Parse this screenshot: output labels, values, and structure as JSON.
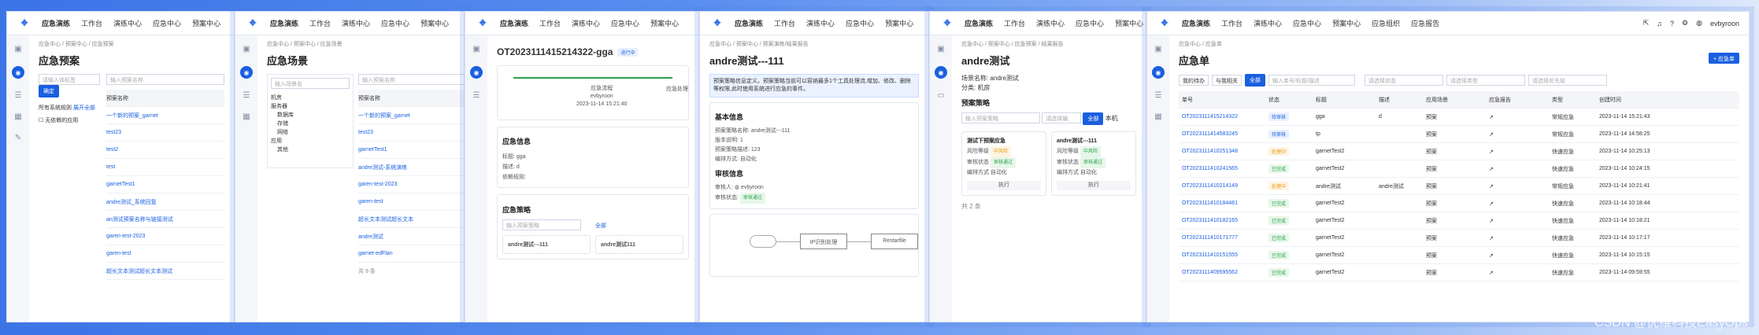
{
  "header": {
    "brand": "应急演练",
    "nav": [
      "工作台",
      "演练中心",
      "应急中心",
      "预案中心",
      "应急组织",
      "应急报告"
    ]
  },
  "p1": {
    "crumb": "应急中心 / 预案中心 / 应急预案",
    "title": "应急预案",
    "search_placeholder": "请输入体标签",
    "btn": "确定",
    "sys": "所有系统规则",
    "expand": "展开全部",
    "check": "无依赖的应用",
    "filter_placeholder": "输入预案名称",
    "col": "预案名称",
    "rows": [
      "一个新的预案_garnet",
      "test23",
      "test2",
      "test",
      "garnetTest1",
      "andre测试_系统回复",
      "an测试预案名称与链接测试",
      "garen-test-2023",
      "garen-test",
      "超长文本测试超长文本测试"
    ]
  },
  "p2": {
    "crumb": "应急中心 / 预案中心 / 应急场景",
    "title": "应急场景",
    "search_placeholder": "输入场景名",
    "tree": [
      "机房",
      "服务器",
      "数据库",
      "存储",
      "网络",
      "应用",
      "其他"
    ],
    "filter_placeholder": "输入预案名称",
    "col": "预案名称",
    "rows": [
      "一个新的预案_garnet",
      "test23",
      "garnetTest1",
      "andre测试-系统演练",
      "garen-test-2023",
      "garen-test",
      "超长文本测试超长文本",
      "andre测试",
      "garnet-edFlan"
    ],
    "footer": "共 9 条"
  },
  "p3": {
    "title": "OT2023111415214322-gga",
    "tag": "进行中",
    "flow_a": "应急流程",
    "flow_b": "应急处理",
    "user": "evbyroon",
    "time": "2023-11-14 15:21:40",
    "sec1": "应急信息",
    "f1": "标题: gga",
    "f2": "描述: d",
    "f3": "依赖规则:",
    "sec2": "应急策略",
    "placeholder": "输入预案策略",
    "card1": "andre测试---111",
    "card2": "andre测试111",
    "all": "全部",
    "num": "123"
  },
  "p4": {
    "crumb": "应急中心 / 预案中心 / 预案演练/结果报告",
    "title": "andre测试---111",
    "note": "预案策略信息定义。预案策略当前可以容纳最多1个工具处理流,增加、修改、删除等权限,此时使用系统进行应急的事件。",
    "sec1": "基本信息",
    "f1": "预案策略名称: andre测试---111",
    "f2": "版本说明: 1",
    "f3": "预案策略描述: 123",
    "f4": "编排方式: 自动化",
    "sec2": "审核信息",
    "reviewer": "审核人:",
    "reviewer_name": "evbyroon",
    "status": "审核状态:",
    "status_tag": "审核通过",
    "node1": "IP识别处理",
    "node2": "Restarfile"
  },
  "p5": {
    "crumb": "应急中心 / 预案中心 / 应急预案 / 结果报告",
    "title": "andre测试",
    "f1": "场景名称: andre测试",
    "f2": "分类: 机房",
    "sec": "预案策略",
    "placeholder": "输入预案策略",
    "sel": "请选择编",
    "all": "全部",
    "mine": "本机",
    "c1": "测试下预案应急",
    "c2": "andre测试---111",
    "k1": "风险等级",
    "k2": "审核状态",
    "k3": "编排方式",
    "v1": "中风险",
    "v2": "审核通过",
    "v3": "自动化",
    "run": "执行",
    "footer": "共 2 条"
  },
  "p6": {
    "crumb": "应急中心 / 应急单",
    "title": "应急单",
    "add": "+ 应急单",
    "tabs": [
      "我的待办",
      "与我相关",
      "全部"
    ],
    "search": "输入单号/标题/描述",
    "sel1": "请选择状态",
    "sel2": "请选择类型",
    "sel3": "请选择优先级",
    "user": "evbyroon",
    "cols": [
      "单号",
      "状态",
      "标题",
      "描述",
      "应用场景",
      "应急报告",
      "类型",
      "创建时间"
    ],
    "rows": [
      [
        "OT2023111415214322",
        "待审核",
        "gga",
        "d",
        "预案",
        "↗",
        "常规应急",
        "2023-11-14 15:21:43"
      ],
      [
        "OT2023111414583245",
        "待审核",
        "tp",
        "",
        "预案",
        "↗",
        "常规应急",
        "2023-11-14 14:58:25"
      ],
      [
        "OT2023111410251348",
        "处理中",
        "garnetTest2",
        "",
        "预案",
        "↗",
        "快速应急",
        "2023-11-14 10:25:13"
      ],
      [
        "OT2023111410241565",
        "已完成",
        "garnetTest2",
        "",
        "预案",
        "↗",
        "快速应急",
        "2023-11-14 10:24:15"
      ],
      [
        "OT2023111410214149",
        "处理中",
        "andre测试",
        "andre测试",
        "预案",
        "↗",
        "常规应急",
        "2023-11-14 10:21:41"
      ],
      [
        "OT2023111410184481",
        "已完成",
        "garnetTest2",
        "",
        "预案",
        "↗",
        "快速应急",
        "2023-11-14 10:18:44"
      ],
      [
        "OT2023111410182165",
        "已完成",
        "garnetTest2",
        "",
        "预案",
        "↗",
        "快速应急",
        "2023-11-14 10:18:21"
      ],
      [
        "OT2023111410171777",
        "已完成",
        "garnetTest2",
        "",
        "预案",
        "↗",
        "快速应急",
        "2023-11-14 10:17:17"
      ],
      [
        "OT2023111410151555",
        "已完成",
        "garnetTest2",
        "",
        "预案",
        "↗",
        "快速应急",
        "2023-11-14 10:15:15"
      ],
      [
        "OT2023111409595562",
        "已完成",
        "garnetTest2",
        "",
        "预案",
        "↗",
        "快速应急",
        "2023-11-14 09:59:55"
      ]
    ]
  },
  "watermark": "CSDN @优维科技EasyOps",
  "colors": {
    "accent": "#1a5fe0"
  }
}
